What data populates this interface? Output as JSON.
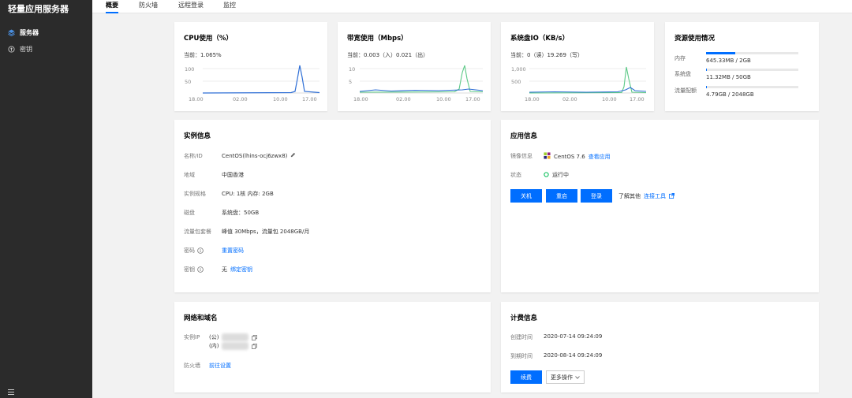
{
  "sidebar": {
    "brand": "轻量应用服务器",
    "items": [
      {
        "label": "服务器",
        "icon": "server-icon",
        "active": true
      },
      {
        "label": "密钥",
        "icon": "key-icon",
        "active": false
      }
    ]
  },
  "tabs": [
    {
      "label": "概要",
      "active": true
    },
    {
      "label": "防火墙",
      "active": false
    },
    {
      "label": "远程登录",
      "active": false
    },
    {
      "label": "监控",
      "active": false
    }
  ],
  "cpu": {
    "title": "CPU使用（%）",
    "current": "当前：1.065%",
    "chart_data": {
      "type": "line",
      "y_ticks": [
        "100",
        "50"
      ],
      "x_ticks": [
        "18.00",
        "02.00",
        "10.00",
        "17.00"
      ],
      "series_color": "#2f6fd6"
    }
  },
  "bandwidth": {
    "title": "带宽使用（Mbps）",
    "current": "当前：0.003（入）0.021（出）",
    "chart_data": {
      "type": "line",
      "y_ticks": [
        "10",
        "5"
      ],
      "x_ticks": [
        "18.00",
        "02.00",
        "10.00",
        "17.00"
      ],
      "series_colors": [
        "#5cc987",
        "#2f6fd6"
      ]
    }
  },
  "diskio": {
    "title": "系统盘IO（KB/s）",
    "current": "当前：0（读）19.269（写）",
    "chart_data": {
      "type": "line",
      "y_ticks": [
        "1,000",
        "500"
      ],
      "x_ticks": [
        "18.00",
        "02.00",
        "10.00",
        "17.00"
      ],
      "series_colors": [
        "#5cc987",
        "#2f6fd6"
      ]
    }
  },
  "resources": {
    "title": "资源使用情况",
    "rows": [
      {
        "label": "内存",
        "value": "645.33MB / 2GB",
        "fraction": 0.315
      },
      {
        "label": "系统盘",
        "value": "11.32MB / 50GB",
        "fraction": 0.002
      },
      {
        "label": "流量配额",
        "value": "4.79GB / 2048GB",
        "fraction": 0.002
      }
    ],
    "accent": "#006eff"
  },
  "instance": {
    "title": "实例信息",
    "rows": [
      {
        "label": "名称/ID",
        "value": "CentOS(lhins-ocj6zwx8)",
        "type": "edit"
      },
      {
        "label": "地域",
        "value": "中国香港",
        "type": "text"
      },
      {
        "label": "实例规格",
        "value": "CPU: 1核 内存: 2GB",
        "type": "text"
      },
      {
        "label": "磁盘",
        "value": "系统盘：50GB",
        "type": "text"
      },
      {
        "label": "流量包套餐",
        "value": "峰值 30Mbps，流量包 2048GB/月",
        "type": "text"
      },
      {
        "label": "密码",
        "value": "重置密码",
        "type": "link-info"
      },
      {
        "label": "密钥",
        "value_prefix": "无",
        "value": "绑定密钥",
        "type": "prefix-link-info"
      }
    ]
  },
  "app": {
    "title": "应用信息",
    "image_label": "镜像信息",
    "image_value": "CentOS 7.6",
    "image_link": "查看应用",
    "status_label": "状态",
    "status_value": "运行中",
    "status_color": "#0abf5b",
    "buttons": [
      "关机",
      "重启",
      "登录"
    ],
    "learn_prefix": "了解其他",
    "learn_link": "连接工具"
  },
  "network": {
    "title": "网络和域名",
    "ip_label": "实例IP",
    "public_prefix": "(公)",
    "private_prefix": "(内)",
    "firewall_label": "防火墙",
    "firewall_link": "前往设置"
  },
  "billing": {
    "title": "计费信息",
    "created_label": "创建时间",
    "created_value": "2020-07-14 09:24:09",
    "expire_label": "到期时间",
    "expire_value": "2020-08-14 09:24:09",
    "renew_button": "续费",
    "more_button": "更多操作"
  }
}
